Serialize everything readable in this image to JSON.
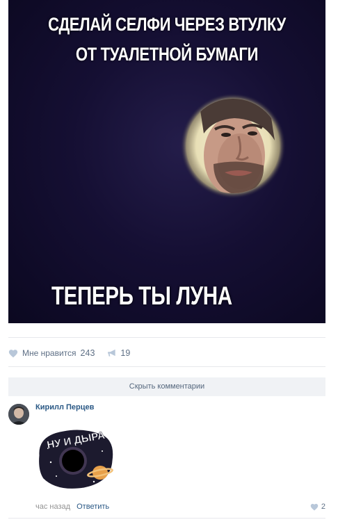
{
  "post": {
    "meme_top_line1": "СДЕЛАЙ СЕЛФИ ЧЕРЕЗ ВТУЛКУ",
    "meme_top_line2": "ОТ ТУАЛЕТНОЙ БУМАГИ",
    "meme_bottom": "ТЕПЕРЬ ТЫ ЛУНА"
  },
  "actions": {
    "like_label": "Мне нравится",
    "like_count": "243",
    "share_count": "19"
  },
  "comments": {
    "hide_label": "Скрыть комментарии",
    "items": [
      {
        "author": "Кирилл Перцев",
        "sticker_text": "НУ И ДЫРА",
        "time": "час назад",
        "reply_label": "Ответить",
        "likes": "2"
      }
    ]
  },
  "colors": {
    "link": "#2a5885",
    "muted": "#939393",
    "action": "#5e6f85",
    "icon": "#b8c7d9",
    "hide_bg": "#f0f2f5"
  }
}
